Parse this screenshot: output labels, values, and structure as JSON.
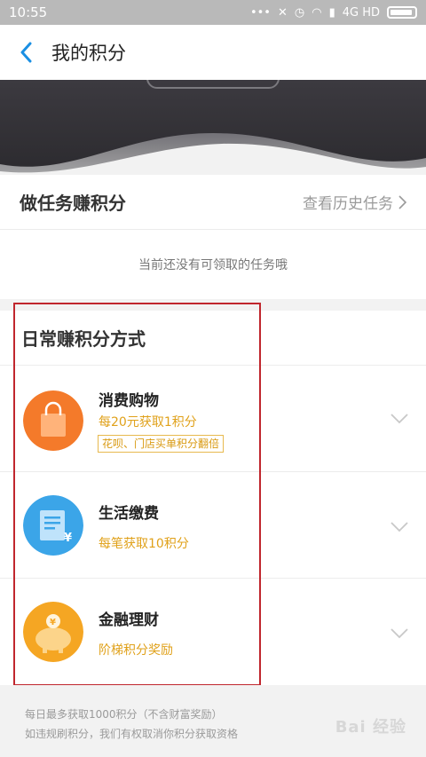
{
  "status_bar": {
    "time": "10:55",
    "network": "4G HD"
  },
  "nav": {
    "title": "我的积分"
  },
  "tasks": {
    "title": "做任务赚积分",
    "history_link": "查看历史任务",
    "empty_text": "当前还没有可领取的任务哦"
  },
  "daily": {
    "title": "日常赚积分方式",
    "items": [
      {
        "name": "消费购物",
        "desc": "每20元获取1积分",
        "tag": "花呗、门店买单积分翻倍",
        "icon": "shopping-bag-icon",
        "color": "#f47a2a"
      },
      {
        "name": "生活缴费",
        "desc": "每笔获取10积分",
        "tag": "",
        "icon": "bill-icon",
        "color": "#3ba5e8"
      },
      {
        "name": "金融理财",
        "desc": "阶梯积分奖励",
        "tag": "",
        "icon": "piggy-bank-icon",
        "color": "#f5a623"
      }
    ]
  },
  "footer": {
    "line1": "每日最多获取1000积分（不含财富奖励）",
    "line2": "如违规刷积分，我们有权取消你积分获取资格"
  },
  "watermark": "Bai 经验"
}
